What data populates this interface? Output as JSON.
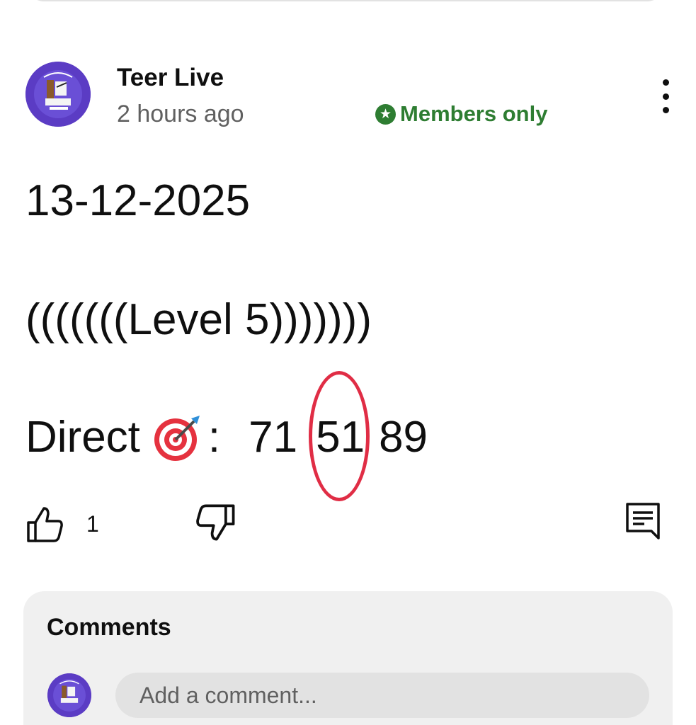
{
  "post": {
    "channel_name": "Teer Live",
    "timestamp": "2 hours ago",
    "badge": {
      "label": "Members only",
      "icon": "star-circle-icon",
      "color": "#2e7d32"
    },
    "more_icon": "vertical-ellipsis-icon",
    "body": {
      "date_line": "13-12-2025",
      "level_line": "(((((((Level 5)))))))",
      "direct_label": "Direct",
      "direct_icon": "direct-hit-target-emoji",
      "separator": ":",
      "numbers": [
        "71",
        "51",
        "89"
      ],
      "highlighted_number": "51",
      "highlight_color": "#e02d45"
    },
    "actions": {
      "like_icon": "thumbs-up-icon",
      "like_count": "1",
      "dislike_icon": "thumbs-down-icon",
      "comment_icon": "comment-icon"
    }
  },
  "comments": {
    "title": "Comments",
    "input_placeholder": "Add a comment..."
  }
}
